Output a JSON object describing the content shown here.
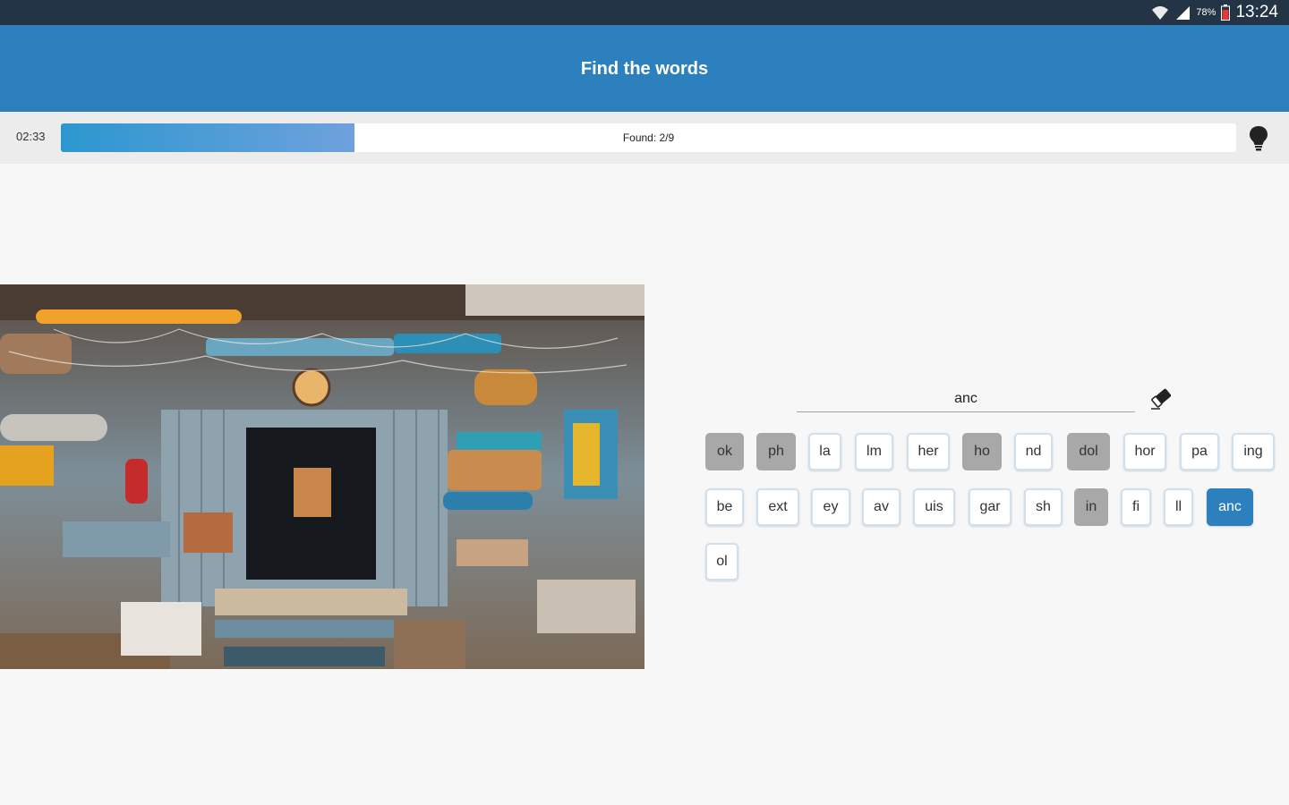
{
  "status_bar": {
    "time": "13:24",
    "battery": "78%",
    "icons": [
      "wifi-icon",
      "signal-icon",
      "battery-icon"
    ]
  },
  "app_bar": {
    "title": "Find the words"
  },
  "progress": {
    "timer": "02:33",
    "found_label": "Found: 2/9",
    "fraction": 0.25,
    "hint_icon": "lightbulb-icon"
  },
  "answer": {
    "value": "anc",
    "clear_icon": "eraser-icon"
  },
  "tiles": [
    {
      "label": "ok",
      "state": "used"
    },
    {
      "label": "ph",
      "state": "used"
    },
    {
      "label": "la",
      "state": "normal"
    },
    {
      "label": "lm",
      "state": "normal"
    },
    {
      "label": "her",
      "state": "normal"
    },
    {
      "label": "ho",
      "state": "used"
    },
    {
      "label": "nd",
      "state": "normal"
    },
    {
      "label": "dol",
      "state": "used"
    },
    {
      "label": "hor",
      "state": "normal"
    },
    {
      "label": "pa",
      "state": "normal"
    },
    {
      "label": "ing",
      "state": "normal"
    },
    {
      "label": "be",
      "state": "normal"
    },
    {
      "label": "ext",
      "state": "normal"
    },
    {
      "label": "ey",
      "state": "normal"
    },
    {
      "label": "av",
      "state": "normal"
    },
    {
      "label": "uis",
      "state": "normal"
    },
    {
      "label": "gar",
      "state": "normal"
    },
    {
      "label": "sh",
      "state": "normal"
    },
    {
      "label": "in",
      "state": "used"
    },
    {
      "label": "fi",
      "state": "normal"
    },
    {
      "label": "ll",
      "state": "normal"
    },
    {
      "label": "anc",
      "state": "selected"
    },
    {
      "label": "ol",
      "state": "normal"
    }
  ],
  "colors": {
    "primary": "#2c80bd",
    "status_bar": "#243447",
    "used_tile": "#a8a8a8"
  }
}
